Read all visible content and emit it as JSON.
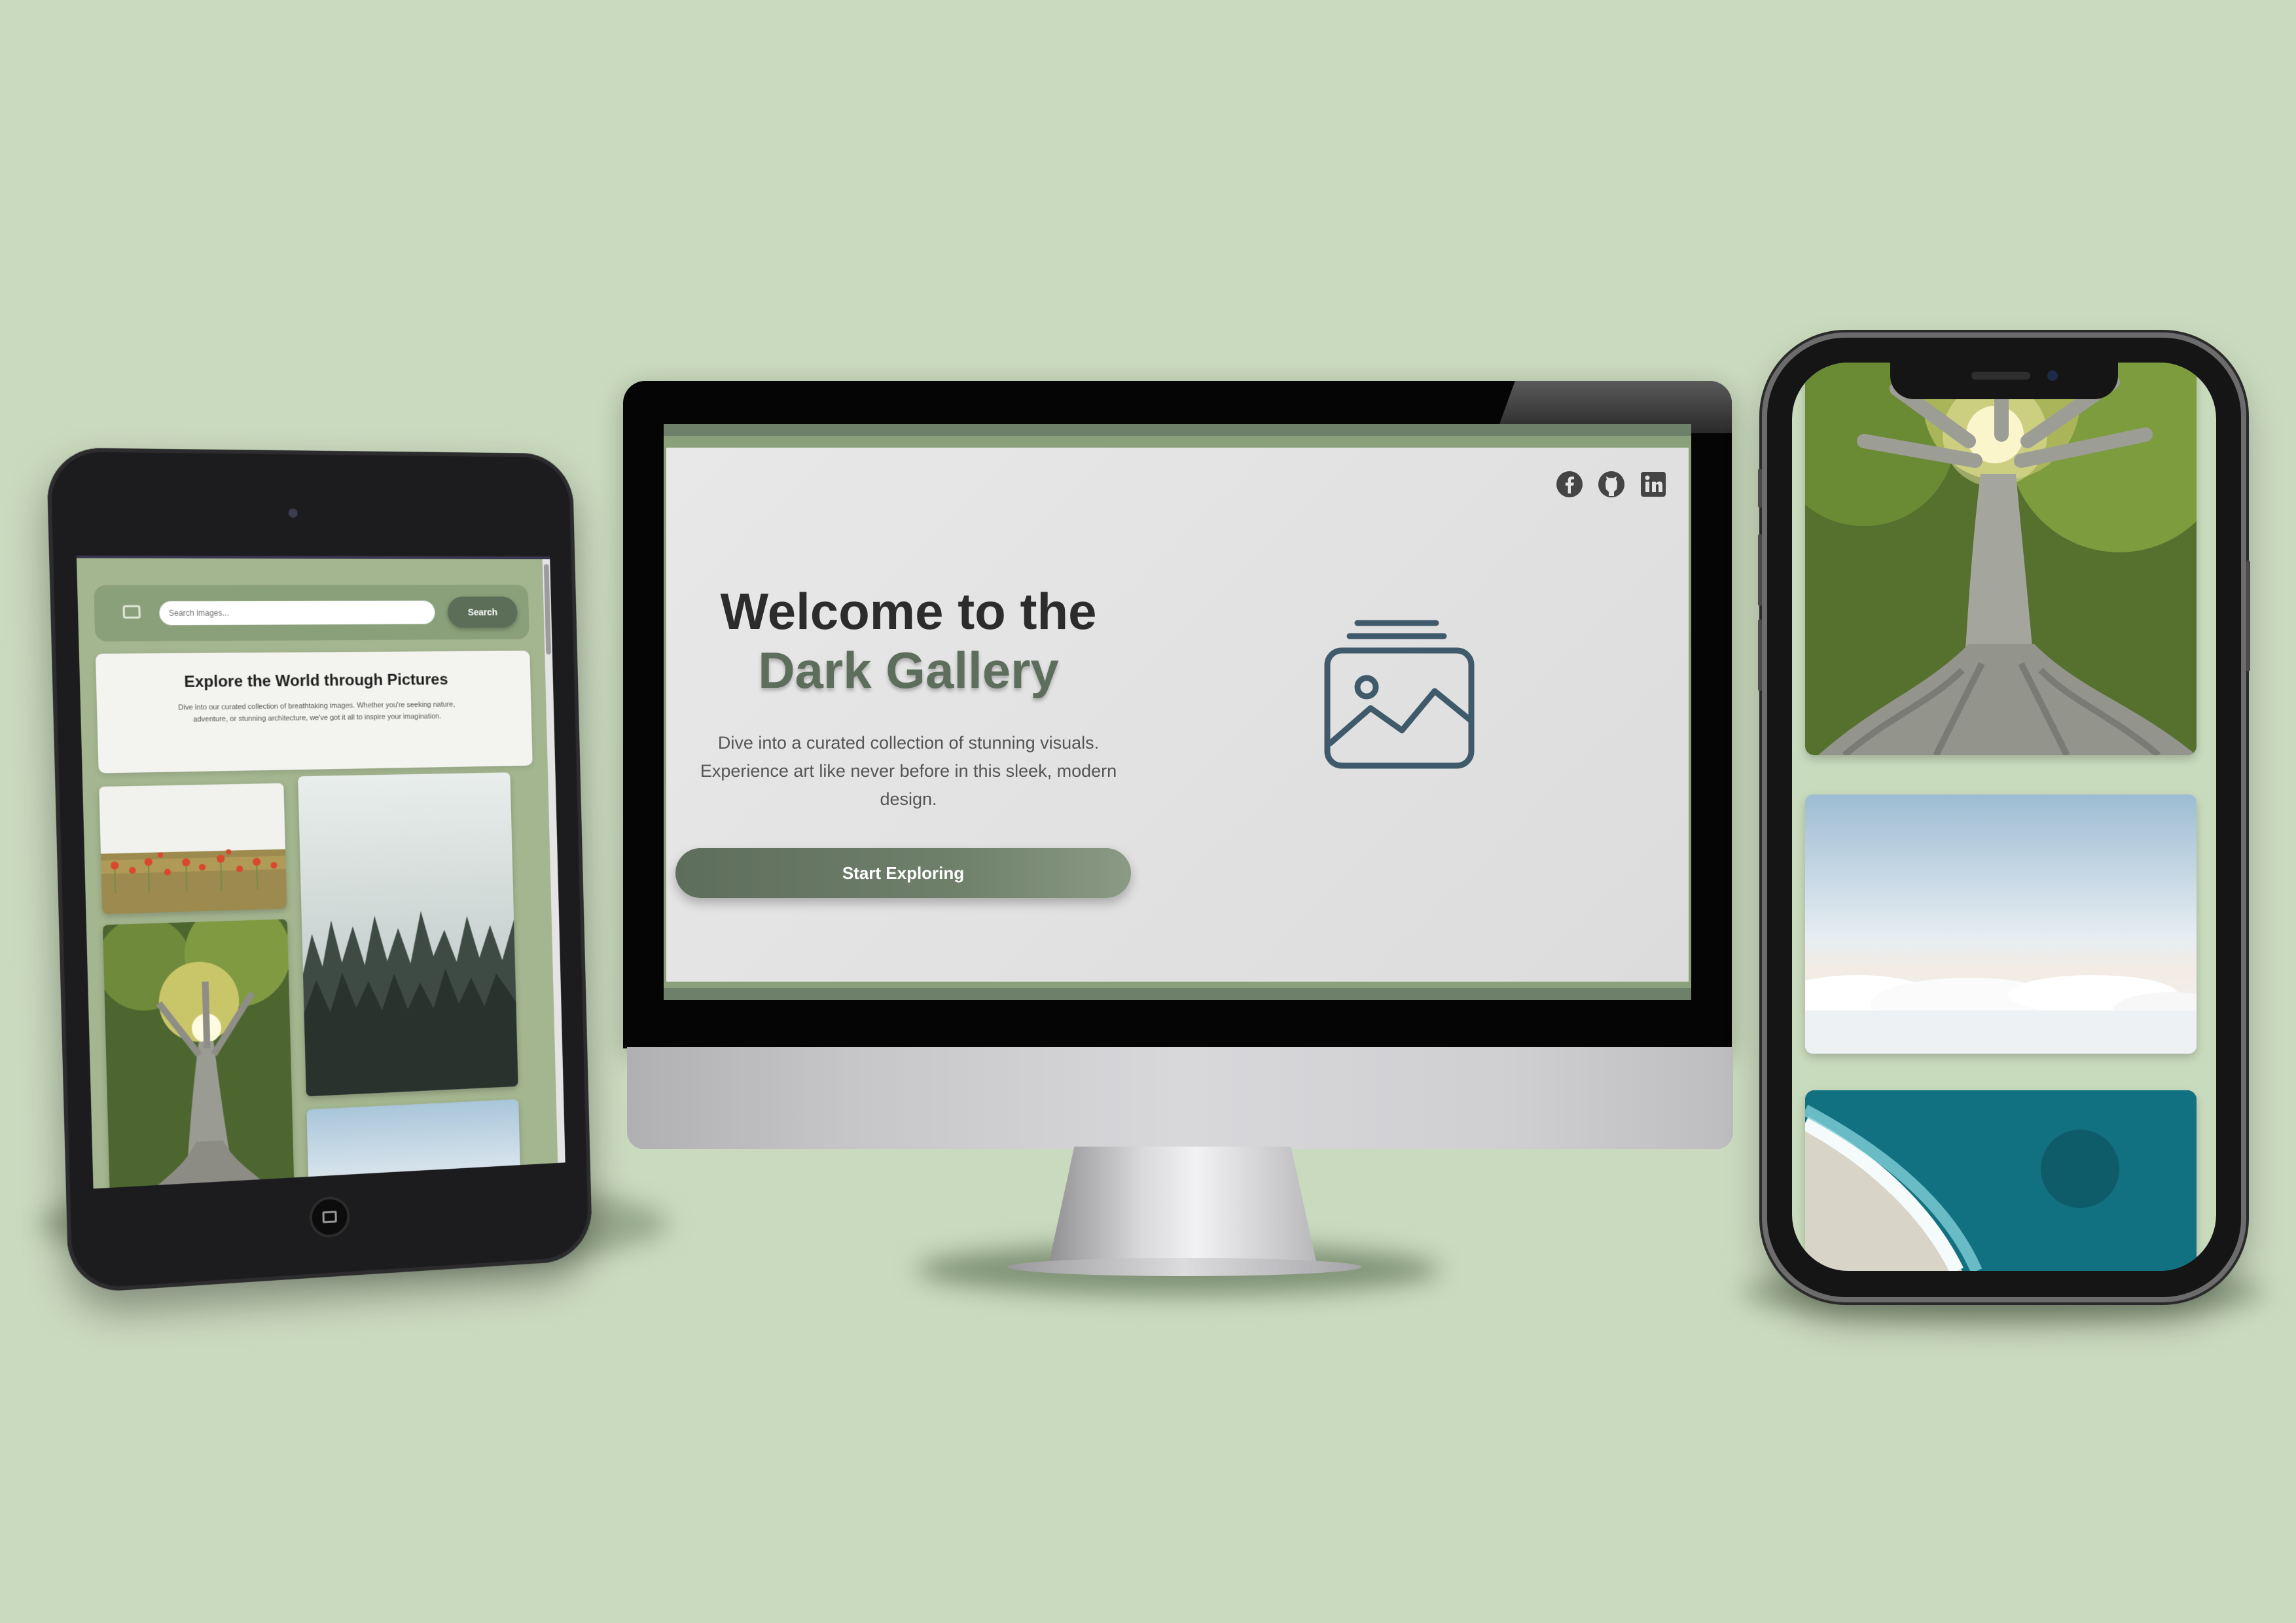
{
  "tablet": {
    "search_placeholder": "Search images...",
    "search_button": "Search",
    "hero_title": "Explore the World through Pictures",
    "hero_text": "Dive into our curated collection of breathtaking images. Whether you're seeking nature, adventure, or stunning architecture, we've got it all to inspire your imagination."
  },
  "desktop": {
    "title_line1": "Welcome to the",
    "title_line2": "Dark Gallery",
    "description": "Dive into a curated collection of stunning visuals. Experience art like never before in this sleek, modern design.",
    "cta_label": "Start Exploring",
    "social_icons": [
      "facebook-icon",
      "github-icon",
      "linkedin-icon"
    ],
    "hero_icon": "gallery-image-icon"
  },
  "phone": {
    "images": [
      "tree-photo",
      "clouds-photo",
      "ocean-beach-photo"
    ]
  },
  "colors": {
    "background": "#cadabe",
    "accent": "#5e6e5c",
    "nav_green": "#8aa07a",
    "icon_slate": "#3f5a6b"
  }
}
